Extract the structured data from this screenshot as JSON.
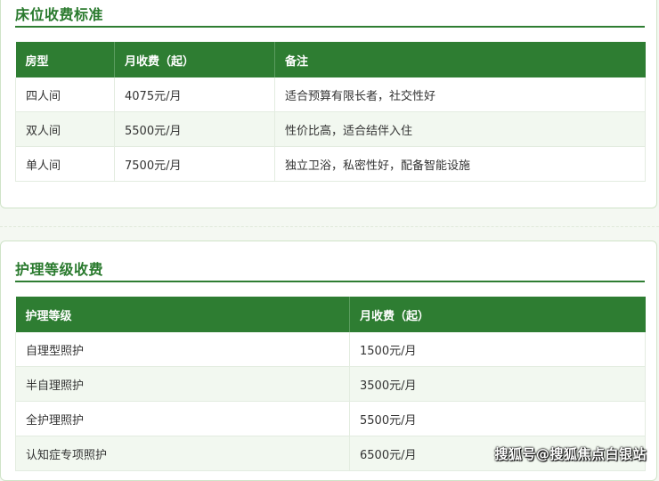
{
  "bed_section": {
    "title": "床位收费标准",
    "headers": [
      "房型",
      "月收费（起）",
      "备注"
    ],
    "rows": [
      [
        "四人间",
        "4075元/月",
        "适合预算有限长者，社交性好"
      ],
      [
        "双人间",
        "5500元/月",
        "性价比高，适合结伴入住"
      ],
      [
        "单人间",
        "7500元/月",
        "独立卫浴，私密性好，配备智能设施"
      ]
    ]
  },
  "care_section": {
    "title": "护理等级收费",
    "headers": [
      "护理等级",
      "月收费（起）"
    ],
    "rows": [
      [
        "自理型照护",
        "1500元/月"
      ],
      [
        "半自理照护",
        "3500元/月"
      ],
      [
        "全护理照护",
        "5500元/月"
      ],
      [
        "认知症专项照护",
        "6500元/月"
      ]
    ]
  },
  "watermark": "搜狐号@搜狐焦点白银站",
  "colors": {
    "header_green": "#2e7d32",
    "title_green": "#2a7a2e",
    "stripe": "#f2f8f0"
  }
}
